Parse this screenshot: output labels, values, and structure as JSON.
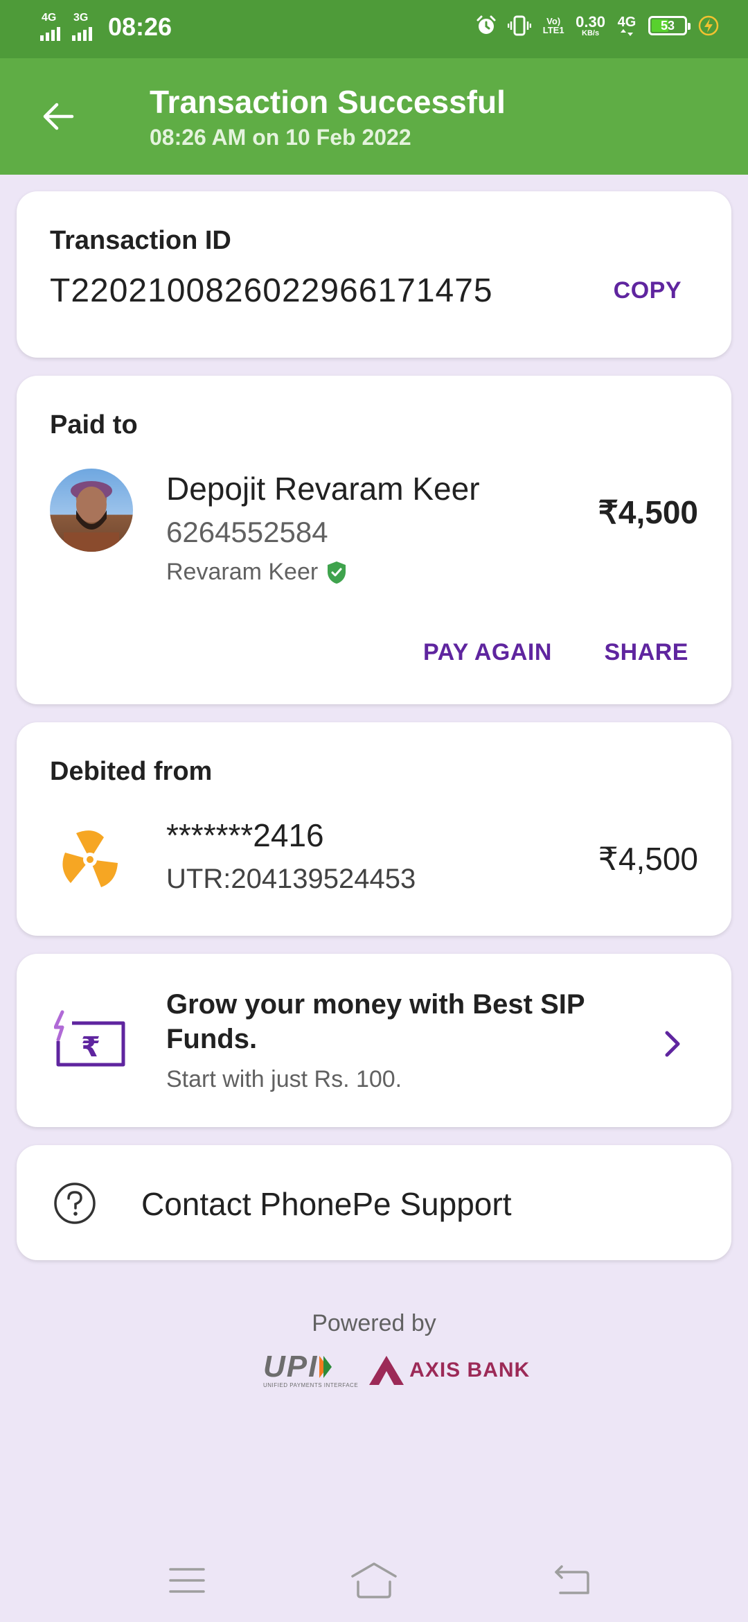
{
  "status_bar": {
    "network1": "4G",
    "network2": "3G",
    "time": "08:26",
    "volte": "Vo) LTE1",
    "speed_value": "0.30",
    "speed_unit": "KB/s",
    "network3": "4G",
    "battery": "53"
  },
  "header": {
    "title": "Transaction Successful",
    "subtitle": "08:26 AM on 10 Feb 2022"
  },
  "transaction": {
    "label": "Transaction ID",
    "id": "T2202100826022966171475",
    "copy_label": "COPY"
  },
  "paid_to": {
    "label": "Paid to",
    "name": "Depojit Revaram Keer",
    "phone": "6264552584",
    "bank_name": "Revaram Keer",
    "amount": "₹4,500",
    "pay_again_label": "PAY AGAIN",
    "share_label": "SHARE"
  },
  "debited_from": {
    "label": "Debited from",
    "account": "*******2416",
    "utr": "UTR:204139524453",
    "amount": "₹4,500"
  },
  "promo": {
    "title": "Grow your money with Best SIP Funds.",
    "subtitle": "Start with just Rs. 100."
  },
  "support": {
    "label": "Contact PhonePe Support"
  },
  "footer": {
    "powered_by": "Powered by",
    "upi_logo": "UPI",
    "upi_tagline": "UNIFIED PAYMENTS INTERFACE",
    "bank_logo": "AXIS BANK"
  },
  "colors": {
    "status_bar": "#4e9b39",
    "header": "#5fad45",
    "background": "#ede6f6",
    "accent": "#5f259f",
    "verified": "#3fa34d"
  },
  "icons": {
    "back": "arrow-left-icon",
    "verified": "verified-shield-icon",
    "bank": "icici-bank-icon",
    "promo": "sip-rupee-icon",
    "chevron": "chevron-right-icon",
    "help": "help-circle-icon"
  }
}
